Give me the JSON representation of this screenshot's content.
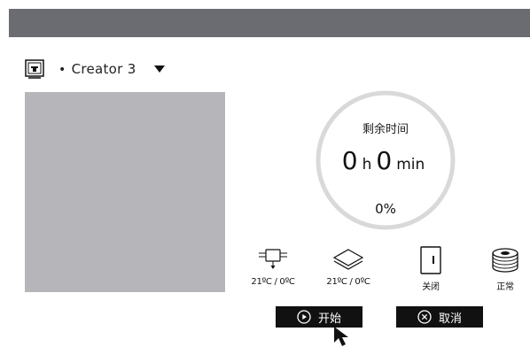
{
  "printer": {
    "bullet": "•",
    "name": "Creator 3"
  },
  "timer": {
    "label": "剩余时间",
    "hours": "0",
    "hours_unit": "h",
    "minutes": "0",
    "minutes_unit": "min",
    "percent": "0%"
  },
  "status": {
    "extruder_temp": "21ºC / 0ºC",
    "bed_temp": "21ºC / 0ºC",
    "door": "关闭",
    "filament": "正常"
  },
  "actions": {
    "start_label": "开始",
    "cancel_label": "取消"
  },
  "progress": 0,
  "colors": {
    "titlebar": "#6b6c71",
    "preview": "#b6b6ba",
    "ring": "#d9d9d9",
    "button": "#111111"
  }
}
